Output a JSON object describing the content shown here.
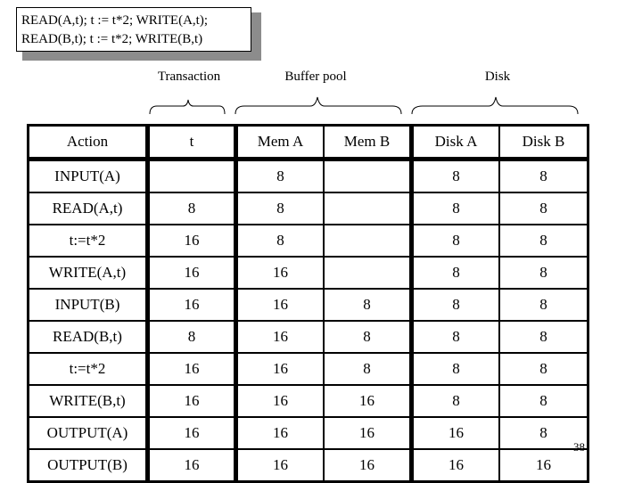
{
  "code_box": {
    "lines": [
      "READ(A,t); t := t*2; WRITE(A,t);",
      "READ(B,t); t := t*2; WRITE(B,t)"
    ]
  },
  "groups": [
    {
      "label": "Transaction"
    },
    {
      "label": "Buffer pool"
    },
    {
      "label": "Disk"
    }
  ],
  "table": {
    "headers": [
      "Action",
      "t",
      "Mem A",
      "Mem B",
      "Disk A",
      "Disk B"
    ],
    "rows": [
      [
        "INPUT(A)",
        "",
        "8",
        "",
        "8",
        "8"
      ],
      [
        "READ(A,t)",
        "8",
        "8",
        "",
        "8",
        "8"
      ],
      [
        "t:=t*2",
        "16",
        "8",
        "",
        "8",
        "8"
      ],
      [
        "WRITE(A,t)",
        "16",
        "16",
        "",
        "8",
        "8"
      ],
      [
        "INPUT(B)",
        "16",
        "16",
        "8",
        "8",
        "8"
      ],
      [
        "READ(B,t)",
        "8",
        "16",
        "8",
        "8",
        "8"
      ],
      [
        "t:=t*2",
        "16",
        "16",
        "8",
        "8",
        "8"
      ],
      [
        "WRITE(B,t)",
        "16",
        "16",
        "16",
        "8",
        "8"
      ],
      [
        "OUTPUT(A)",
        "16",
        "16",
        "16",
        "16",
        "8"
      ],
      [
        "OUTPUT(B)",
        "16",
        "16",
        "16",
        "16",
        "16"
      ]
    ]
  },
  "page_number": "38"
}
